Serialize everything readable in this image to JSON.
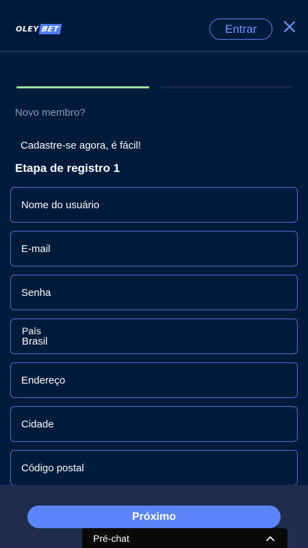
{
  "header": {
    "logo_part1": "OLEY",
    "logo_part2": "BET",
    "login_label": "Entrar",
    "close_icon": "close-icon"
  },
  "progress": {
    "steps_total": 2,
    "current_step": 1,
    "active_color": "#9be5a0",
    "inactive_color": "#17284a"
  },
  "intro": {
    "new_member": "Novo membro?",
    "signup_text": "Cadastre-se agora, é fácil!",
    "step_title": "Etapa de registro 1"
  },
  "form": {
    "username_placeholder": "Nome do usuário",
    "email_placeholder": "E-mail",
    "password_placeholder": "Senha",
    "country_label": "País",
    "country_value": "Brasil",
    "address_placeholder": "Endereço",
    "city_placeholder": "Cidade",
    "postal_placeholder": "Código postal"
  },
  "footer": {
    "next_label": "Próximo",
    "prechat_label": "Pré-chat",
    "prechat_icon": "chevron-up-icon"
  },
  "colors": {
    "background": "#001b3c",
    "accent": "#5b84f6",
    "field_border": "#4f6fd8"
  }
}
